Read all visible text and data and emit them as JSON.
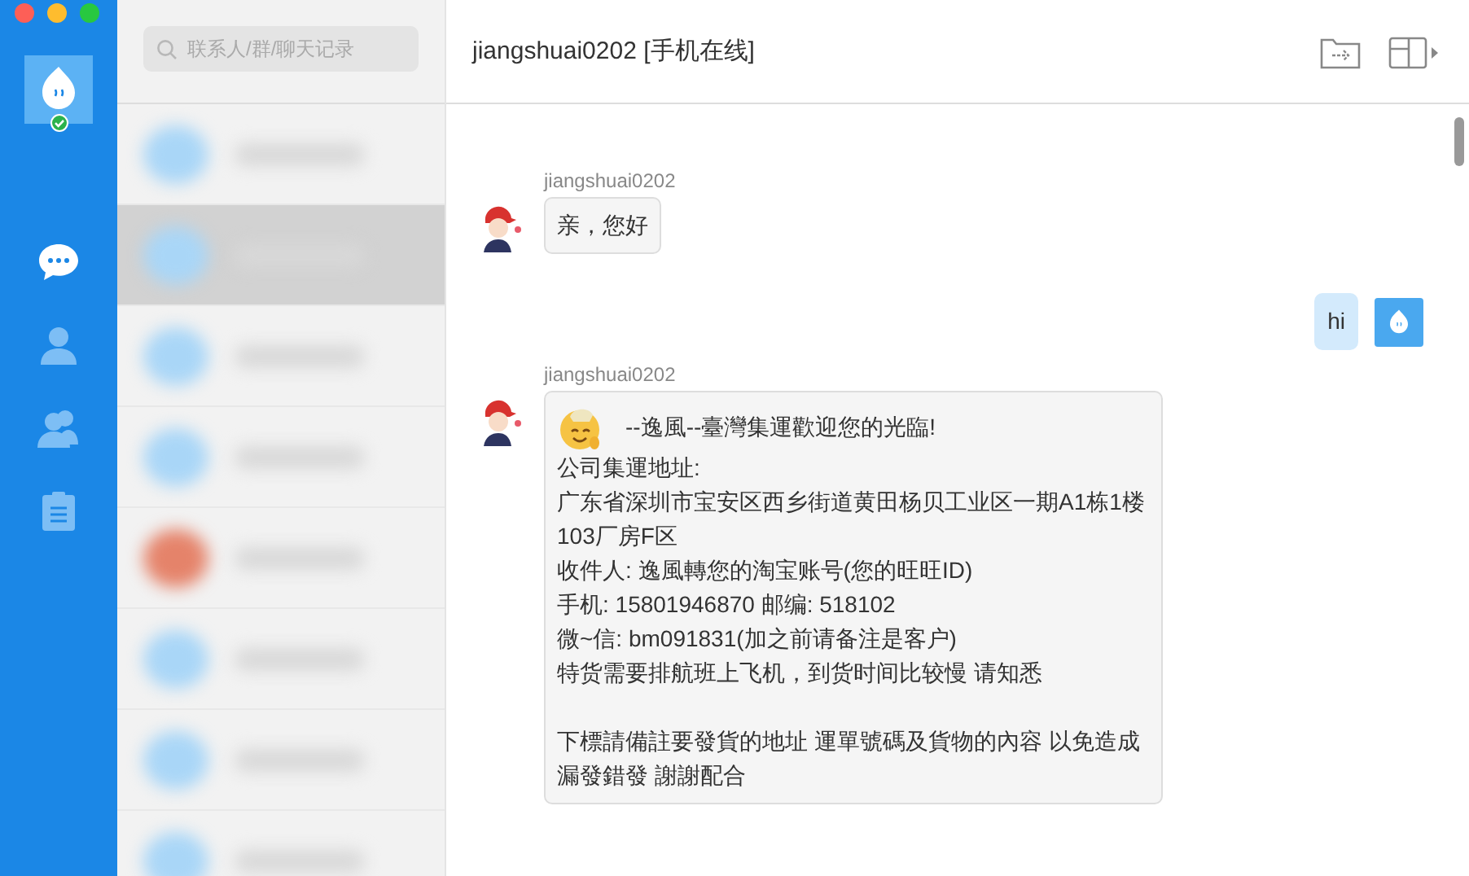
{
  "nav": [
    {
      "kind": "chat",
      "selected": true
    },
    {
      "kind": "contact",
      "selected": false
    },
    {
      "kind": "group",
      "selected": false
    },
    {
      "kind": "clipboard",
      "selected": false
    }
  ],
  "profile": {
    "online": true
  },
  "search": {
    "placeholder": "联系人/群/聊天记录"
  },
  "conversations": [
    {
      "selected": false,
      "color": "#a9d6f7"
    },
    {
      "selected": true,
      "color": "#a9d6f7"
    },
    {
      "selected": false,
      "color": "#a9d6f7"
    },
    {
      "selected": false,
      "color": "#a9d6f7"
    },
    {
      "selected": false,
      "color": "#e5836a"
    },
    {
      "selected": false,
      "color": "#a9d6f7"
    },
    {
      "selected": false,
      "color": "#a9d6f7"
    },
    {
      "selected": false,
      "color": "#a9d6f7"
    }
  ],
  "chat": {
    "title": "jiangshuai0202 [手机在线]"
  },
  "messages": [
    {
      "kind": "incoming",
      "sender": "jiangshuai0202",
      "paragraphs": [
        [
          "亲，您好"
        ]
      ]
    },
    {
      "kind": "outgoing",
      "paragraphs": [
        [
          "hi"
        ]
      ]
    },
    {
      "kind": "incoming",
      "sender": "jiangshuai0202",
      "emoji": true,
      "paragraphs": [
        [
          "--逸風--臺灣集運歡迎您的光臨!",
          "公司集運地址:",
          "广东省深圳市宝安区西乡街道黄田杨贝工业区一期A1栋1楼103厂房F区",
          "收件人: 逸風轉您的淘宝账号(您的旺旺ID)",
          "手机: 15801946870 邮编: 518102",
          " 微~信: bm091831(加之前请备注是客户)",
          "特货需要排航班上飞机，到货时间比较慢 请知悉"
        ],
        [
          "下標請備註要發貨的地址 運單號碼及貨物的內容 以免造成漏發錯發 謝謝配合"
        ]
      ]
    }
  ]
}
